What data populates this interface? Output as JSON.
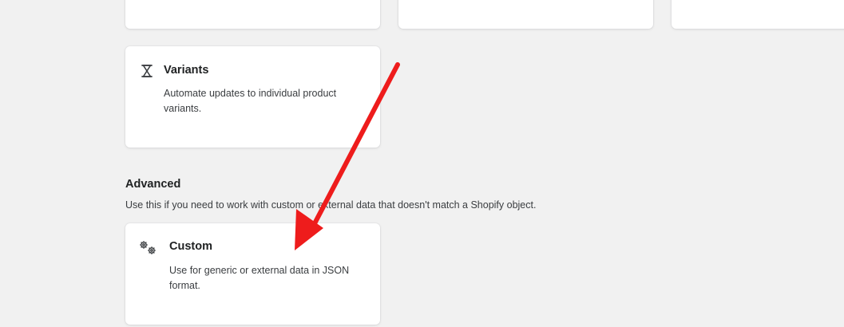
{
  "variants_card": {
    "icon": "hourglass-icon",
    "title": "Variants",
    "description": "Automate updates to individual product variants."
  },
  "advanced_section": {
    "title": "Advanced",
    "description": "Use this if you need to work with custom or external data that doesn't match a Shopify object."
  },
  "custom_card": {
    "icon": "gears-icon",
    "title": "Custom",
    "description": "Use for generic or external data in JSON format."
  },
  "annotation": {
    "arrow_color": "#ee1c1c"
  },
  "colors": {
    "background": "#f1f1f1",
    "card": "#ffffff",
    "text": "#202223"
  }
}
